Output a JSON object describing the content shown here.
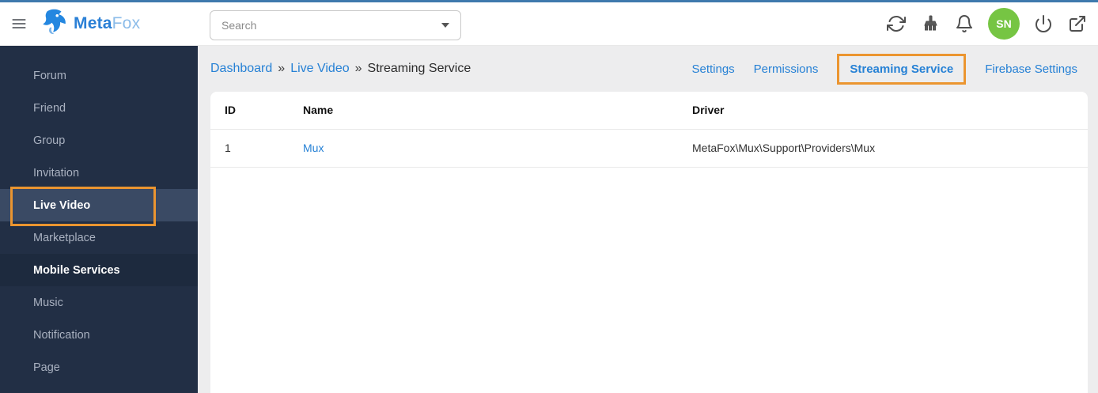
{
  "colors": {
    "topbar-blue": "#3e79ad",
    "accent-orange": "#eb9530",
    "link-blue": "#2681d5",
    "sidebar-bg": "#222f45",
    "sidebar-active-bg": "#3a4a64",
    "sidebar-selected-bg": "#1d2a3e",
    "avatar-green": "#76c543",
    "main-bg": "#ededee"
  },
  "header": {
    "logo": {
      "brand_primary": "Meta",
      "brand_secondary": "Fox",
      "icon": "fox-logo-icon"
    },
    "search": {
      "placeholder": "Search",
      "dropdown_icon": "caret-down-icon"
    },
    "actions": {
      "refresh_icon": "refresh-icon",
      "clear_cache_icon": "broom-icon",
      "notifications_icon": "bell-icon",
      "avatar_initials": "SN",
      "power_icon": "power-icon",
      "external_link_icon": "external-link-icon"
    }
  },
  "sidebar": {
    "items": [
      {
        "label": "Forum",
        "state": "normal"
      },
      {
        "label": "Friend",
        "state": "normal"
      },
      {
        "label": "Group",
        "state": "normal"
      },
      {
        "label": "Invitation",
        "state": "normal"
      },
      {
        "label": "Live Video",
        "state": "active",
        "outlined": true
      },
      {
        "label": "Marketplace",
        "state": "normal"
      },
      {
        "label": "Mobile Services",
        "state": "selected"
      },
      {
        "label": "Music",
        "state": "normal"
      },
      {
        "label": "Notification",
        "state": "normal"
      },
      {
        "label": "Page",
        "state": "normal"
      }
    ]
  },
  "breadcrumb": {
    "separator": "»",
    "items": [
      {
        "label": "Dashboard",
        "type": "link"
      },
      {
        "label": "Live Video",
        "type": "link"
      },
      {
        "label": "Streaming Service",
        "type": "current"
      }
    ]
  },
  "tabs": [
    {
      "label": "Settings",
      "active": false
    },
    {
      "label": "Permissions",
      "active": false
    },
    {
      "label": "Streaming Service",
      "active": true
    },
    {
      "label": "Firebase Settings",
      "active": false
    }
  ],
  "table": {
    "columns": [
      "ID",
      "Name",
      "Driver"
    ],
    "rows": [
      {
        "id": "1",
        "name": "Mux",
        "driver": "MetaFox\\Mux\\Support\\Providers\\Mux"
      }
    ]
  }
}
